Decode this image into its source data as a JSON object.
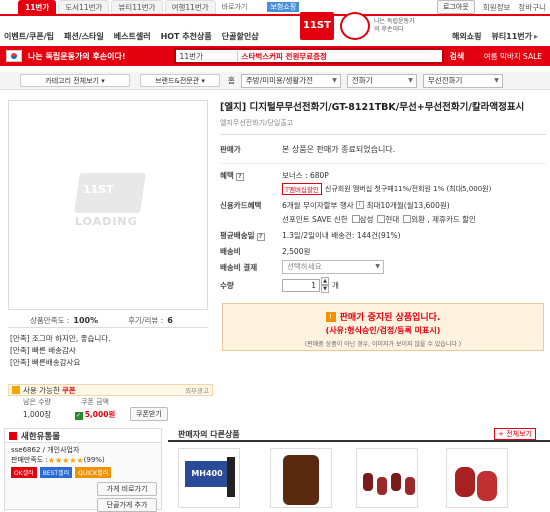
{
  "top_tabs": [
    "11번가",
    "도서11번가",
    "뷰티11번가",
    "여행11번가"
  ],
  "top_extra": "바로가기",
  "top_badge": "보험쇼핑",
  "top_links": [
    "로그아웃",
    "회원정보",
    "장바구니"
  ],
  "logo": {
    "text": "11ST",
    "sub": "나는 독립운동가의 후손이다"
  },
  "nav_left": [
    "이벤트/쿠폰/팁",
    "패션/스타일",
    "베스트셀러",
    "HOT 추천상품",
    "단골할인샵"
  ],
  "nav_right": [
    "해외쇼핑",
    "뷰티11번가"
  ],
  "red_bar": {
    "slogan": "나는 독립운동가의 후손이다!",
    "scope": "11번가",
    "search_text": "스타벅스커피 전원무료증정",
    "search_btn": "검색",
    "right": "여름 막바지 SALE"
  },
  "category_bar": {
    "btn1": "카테고리 전체보기",
    "btn2": "브랜드&전문관",
    "home": "홈",
    "cat1": "주방/미미용/생활가전",
    "cat2": "전화기",
    "cat3": "무선전화기"
  },
  "product": {
    "title": "[엘지] 디지털무무선전화기/GT-8121TBK/무선+무선전화기/칼라액정표시",
    "seller_line": "엘지무선전화기/당일출고",
    "loading": "LOADING",
    "price_label": "판매가",
    "price_value": "본 상품은 판매가 종료되었습니다.",
    "benefit_label": "혜택",
    "bonus": "보너스 : 680P",
    "membership_badge": "T멤버십할인",
    "membership_text": "신규회원 멤버십 첫구매11%/전회원 1% (최대5,000원)",
    "card_label": "신용카드혜택",
    "card_text": "6개월 무이자할부 행사",
    "card_text2": "최대10개월(월13,600원)",
    "savepoint": "선포인트 SAVE  신한",
    "cards": [
      "삼성",
      "현대",
      "외환 , 제휴카드 할인"
    ],
    "avg_label": "평균배송일",
    "avg_text": "1.3일/2일이내 배송건: 144건(91%)",
    "ship_label": "배송비",
    "ship_value": "2,500원",
    "ship_pay_label": "배송비 결제",
    "ship_pay_select": "선택하세요",
    "qty_label": "수량",
    "qty_value": "1",
    "qty_unit": "개",
    "stop_title": "판매가 중지된 상품입니다.",
    "stop_reason": "(사유:형식승인/검정/등록 미표시)",
    "stop_note": "(판매중 상품이 아닌 경우, 이미지가 보이지 않을 수 있습니다.)"
  },
  "satisfaction": {
    "label": "상품만족도 :",
    "value": "100%",
    "review_label": "후기/리뷰 :",
    "review_value": "6"
  },
  "reviews": [
    {
      "tag": "[만족]",
      "text": "조그마 하지만, 좋습니다."
    },
    {
      "tag": "[만족]",
      "text": "빠른 배송감사"
    },
    {
      "tag": "[만족]",
      "text": "빠른배송감사요"
    }
  ],
  "coupon": {
    "title": "사용 가능한",
    "title_em": "쿠폰",
    "ad": "외부광고",
    "col1": "남은 수량",
    "col2": "쿠폰 금액",
    "qty": "1,000장",
    "amount": "5,000원",
    "btn": "쿠폰받기"
  },
  "seller": {
    "title": "새한유통몰",
    "id": "sse6862 / 개인사업자",
    "rating_label": "판매만족도 :",
    "rating_pct": "(99%)",
    "badges": [
      "OK셀러",
      "BEST셀러",
      "QUICK셀러"
    ],
    "btn": "가게 비로가기",
    "btn2": "단골가게 추가"
  },
  "others": {
    "title": "판매자의 다른상품",
    "all_btn": "전체보기",
    "mh": "MH400"
  },
  "colors": {
    "accent": "#e3000f",
    "stop_bg": "#fff3e0",
    "stop_text": "#e3000f"
  }
}
